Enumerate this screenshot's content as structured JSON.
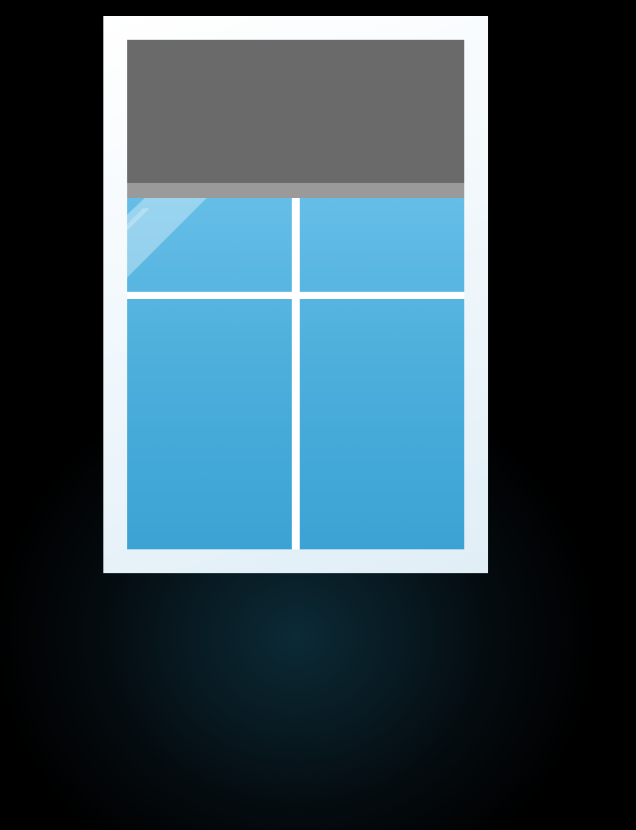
{
  "scene": {
    "description_free": true,
    "colors": {
      "background": "#000000",
      "frame": "#ffffff",
      "glass_top": "#74cbf0",
      "glass_bottom": "#3ba3d4",
      "shade": "#6a6a6a",
      "shade_bar": "#9a9a9a",
      "mullion": "#ffffff"
    },
    "icons": {
      "window": "window-icon",
      "shade": "roller-shade-icon",
      "glare": "glass-glare-icon"
    },
    "shade_level": 0.28
  }
}
